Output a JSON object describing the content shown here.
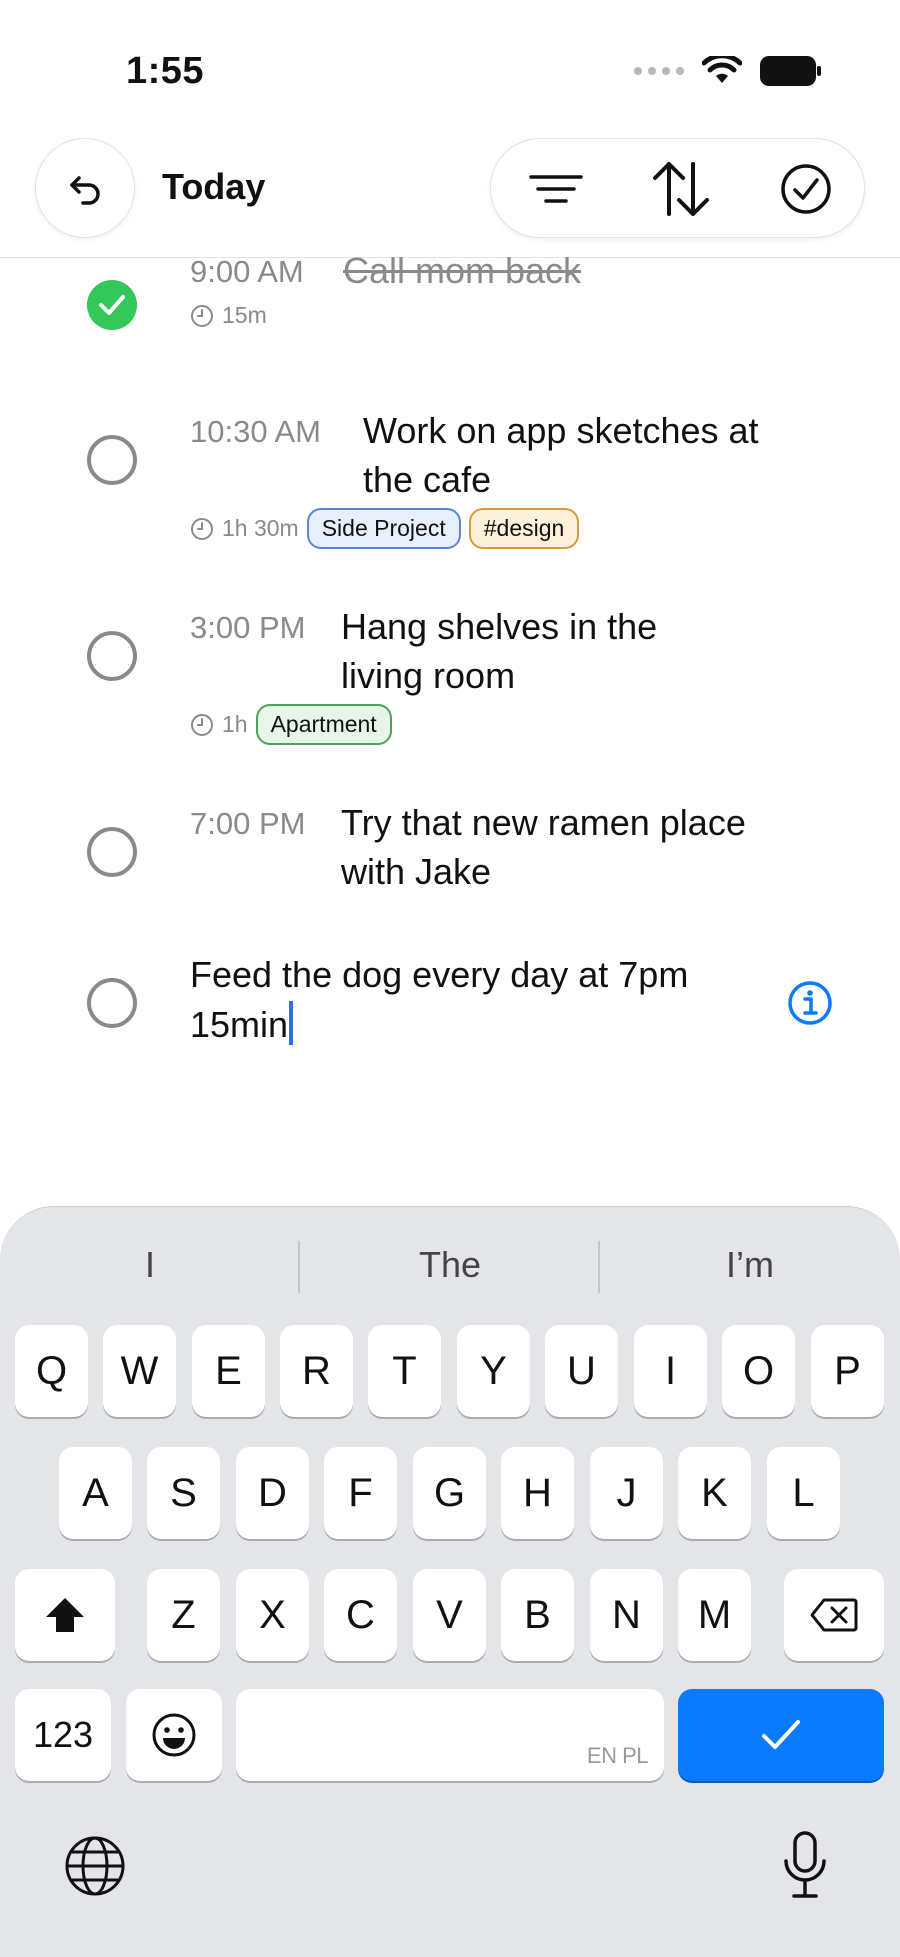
{
  "status_bar": {
    "time": "1:55"
  },
  "header": {
    "title": "Today"
  },
  "tasks": [
    {
      "time": "9:00 AM",
      "title": "Call mom back",
      "duration": "15m",
      "done": true,
      "tags": []
    },
    {
      "time": "10:30 AM",
      "title": "Work on app sketches at the cafe",
      "duration": "1h 30m",
      "done": false,
      "tags": [
        "Side Project",
        "#design"
      ]
    },
    {
      "time": "3:00 PM",
      "title": "Hang shelves in the living room",
      "duration": "1h",
      "done": false,
      "tags": [
        "Apartment"
      ]
    },
    {
      "time": "7:00 PM",
      "title": "Try that new ramen place with Jake",
      "duration": "",
      "done": false,
      "tags": []
    }
  ],
  "new_task": {
    "text": "Feed the dog every day at 7pm 15min"
  },
  "keyboard": {
    "suggestions": [
      "I",
      "The",
      "I’m"
    ],
    "row1": [
      "Q",
      "W",
      "E",
      "R",
      "T",
      "Y",
      "U",
      "I",
      "O",
      "P"
    ],
    "row2": [
      "A",
      "S",
      "D",
      "F",
      "G",
      "H",
      "J",
      "K",
      "L"
    ],
    "row3": [
      "Z",
      "X",
      "C",
      "V",
      "B",
      "N",
      "M"
    ],
    "numbers_label": "123",
    "space_label": "EN PL"
  },
  "colors": {
    "done_check": "#34c759",
    "accent": "#0a7aff",
    "tag_side_project": "#5b86cf",
    "tag_design": "#d99a36",
    "tag_apartment": "#49a45a"
  }
}
